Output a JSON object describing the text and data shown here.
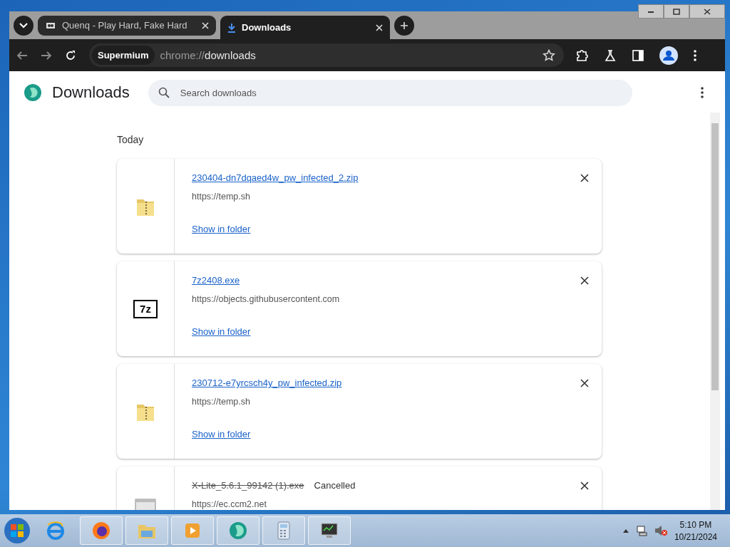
{
  "tabs": [
    {
      "title": "Quenq - Play Hard, Fake Hard",
      "kind": "site",
      "selected": false
    },
    {
      "title": "Downloads",
      "kind": "download",
      "selected": true
    }
  ],
  "toolbar": {
    "site_chip": "Supermium",
    "url_scheme": "chrome://",
    "url_path": "downloads"
  },
  "page": {
    "title": "Downloads",
    "search": {
      "placeholder": "Search downloads"
    },
    "section": "Today",
    "downloads": [
      {
        "file": "230404-dn7dqaed4w_pw_infected_2.zip",
        "source": "https://temp.sh",
        "action": "Show in folder",
        "kind": "zip",
        "cancelled": false
      },
      {
        "file": "7z2408.exe",
        "source": "https://objects.githubusercontent.com",
        "action": "Show in folder",
        "kind": "sevenzip",
        "icon_text": "7z",
        "cancelled": false
      },
      {
        "file": "230712-e7yrcsch4y_pw_infected.zip",
        "source": "https://temp.sh",
        "action": "Show in folder",
        "kind": "zip",
        "cancelled": false
      },
      {
        "file": "X-Lite_5.6.1_99142 (1).exe",
        "status": "Cancelled",
        "source": "https://ec.ccm2.net",
        "kind": "exe",
        "cancelled": true
      }
    ]
  },
  "taskbar": {
    "apps": [
      {
        "kind": "ie",
        "running": false
      },
      {
        "kind": "firefox",
        "running": true
      },
      {
        "kind": "explorer",
        "running": true
      },
      {
        "kind": "media",
        "running": true
      },
      {
        "kind": "browser",
        "running": true
      },
      {
        "kind": "calculator",
        "running": true
      },
      {
        "kind": "monitor",
        "running": true
      }
    ],
    "clock": {
      "time": "5:10 PM",
      "date": "10/21/2024"
    }
  }
}
